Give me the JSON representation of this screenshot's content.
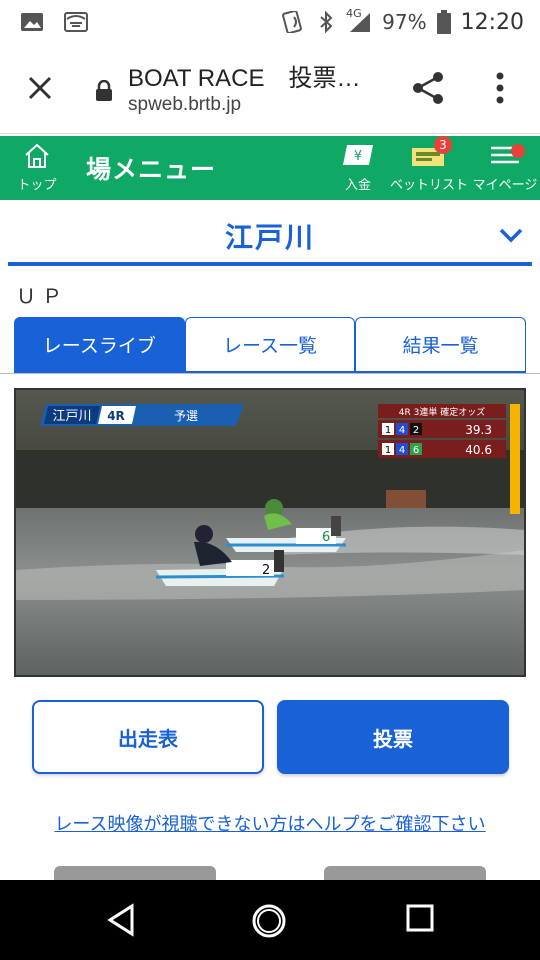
{
  "status_bar": {
    "network": "4G",
    "battery": "97%",
    "time": "12:20",
    "icons": [
      "image-icon",
      "cast-icon",
      "nfc-icon",
      "bluetooth-icon",
      "signal-icon",
      "battery-icon"
    ]
  },
  "browser": {
    "title": "BOAT RACE　投票…",
    "url": "spweb.brtb.jp"
  },
  "nav": {
    "home_label": "トップ",
    "brand": "場メニュー",
    "deposit_label": "入金",
    "betlist_label": "ベットリスト",
    "betlist_badge": "3",
    "mypage_label": "マイページ",
    "accent": "#0fa965"
  },
  "venue": {
    "name": "江戸川"
  },
  "up_text": "ＵＰ",
  "tabs": [
    {
      "label": "レースライブ",
      "active": true
    },
    {
      "label": "レース一覧",
      "active": false
    },
    {
      "label": "結果一覧",
      "active": false
    }
  ],
  "video": {
    "venue": "江戸川",
    "race": "4R",
    "stage": "予選",
    "odds_header": "4R 3連単 確定オッズ",
    "odds": [
      {
        "combo": [
          "1",
          "4",
          "2"
        ],
        "value": "39.3"
      },
      {
        "combo": [
          "1",
          "4",
          "6"
        ],
        "value": "40.6"
      }
    ],
    "boats": [
      "6",
      "2"
    ]
  },
  "buttons": {
    "entry_table": "出走表",
    "vote": "投票"
  },
  "help_link": "レース映像が視聴できない方はヘルプをご確認下さい",
  "colors": {
    "primary": "#1861d7",
    "badge": "#e8403b"
  }
}
